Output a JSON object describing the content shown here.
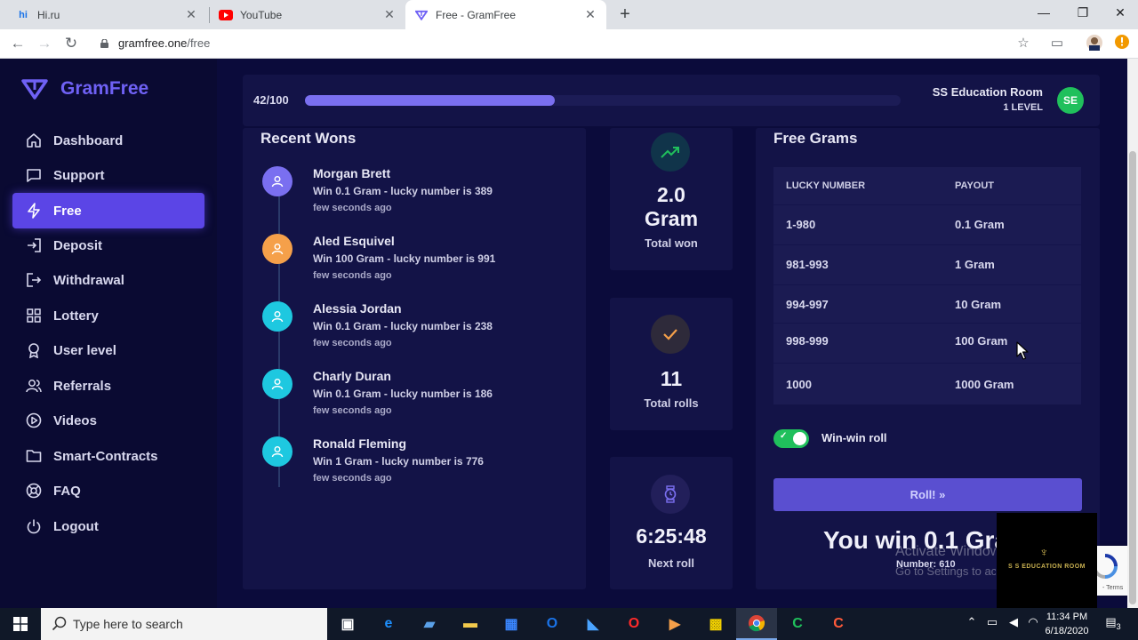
{
  "browser": {
    "tabs": [
      {
        "title": "Hi.ru",
        "icon": "hi-favicon",
        "icon_text": "hi"
      },
      {
        "title": "YouTube",
        "icon": "youtube-favicon"
      },
      {
        "title": "Free - GramFree",
        "icon": "gramfree-favicon",
        "active": true
      }
    ],
    "url_domain": "gramfree.one",
    "url_path": "/free"
  },
  "sidebar": {
    "brand": "GramFree",
    "items": [
      {
        "label": "Dashboard",
        "icon": "home-icon"
      },
      {
        "label": "Support",
        "icon": "chat-icon"
      },
      {
        "label": "Free",
        "icon": "lightning-icon",
        "active": true
      },
      {
        "label": "Deposit",
        "icon": "login-icon"
      },
      {
        "label": "Withdrawal",
        "icon": "logout-arrow-icon"
      },
      {
        "label": "Lottery",
        "icon": "grid-icon"
      },
      {
        "label": "User level",
        "icon": "award-icon"
      },
      {
        "label": "Referrals",
        "icon": "users-icon"
      },
      {
        "label": "Videos",
        "icon": "play-icon"
      },
      {
        "label": "Smart-Contracts",
        "icon": "folder-icon"
      },
      {
        "label": "FAQ",
        "icon": "lifebuoy-icon"
      },
      {
        "label": "Logout",
        "icon": "power-icon"
      }
    ]
  },
  "progress": {
    "label": "42/100",
    "value": 0.42
  },
  "user": {
    "room_name": "SS Education Room",
    "level": "1 LEVEL",
    "initials": "SE"
  },
  "recent": {
    "title": "Recent Wons",
    "items": [
      {
        "name": "Morgan Brett",
        "desc": "Win 0.1 Gram - lucky number is 389",
        "time": "few seconds ago",
        "color": "#7a6ff0"
      },
      {
        "name": "Aled Esquivel",
        "desc": "Win 100 Gram - lucky number is 991",
        "time": "few seconds ago",
        "color": "#f5a04a"
      },
      {
        "name": "Alessia Jordan",
        "desc": "Win 0.1 Gram - lucky number is 238",
        "time": "few seconds ago",
        "color": "#1ec8e0"
      },
      {
        "name": "Charly Duran",
        "desc": "Win 0.1 Gram - lucky number is 186",
        "time": "few seconds ago",
        "color": "#1ec8e0"
      },
      {
        "name": "Ronald Fleming",
        "desc": "Win 1 Gram - lucky number is 776",
        "time": "few seconds ago",
        "color": "#1ec8e0"
      }
    ]
  },
  "stats": {
    "total_won_value": "2.0",
    "total_won_unit": "Gram",
    "total_won_label": "Total won",
    "total_rolls_value": "11",
    "total_rolls_label": "Total rolls",
    "next_roll_value": "6:25:48",
    "next_roll_label": "Next roll"
  },
  "free_grams": {
    "title": "Free Grams",
    "col_lucky": "LUCKY NUMBER",
    "col_payout": "PAYOUT",
    "rows": [
      {
        "lucky": "1-980",
        "payout": "0.1 Gram"
      },
      {
        "lucky": "981-993",
        "payout": "1 Gram"
      },
      {
        "lucky": "994-997",
        "payout": "10 Gram"
      },
      {
        "lucky": "998-999",
        "payout": "100 Gram"
      },
      {
        "lucky": "1000",
        "payout": "1000 Gram"
      }
    ],
    "toggle_label": "Win-win roll",
    "roll_button": "Roll! »",
    "win_text": "You win 0.1 Gram",
    "win_number": "Number: 610"
  },
  "watermark": {
    "line1": "Activate Windows",
    "line2": "Go to Settings to activate Windows."
  },
  "overlay_logo_text": "S S EDUCATION ROOM",
  "recaptcha_terms": "- Terms",
  "taskbar": {
    "search_placeholder": "Type here to search",
    "time": "11:34 PM",
    "date": "6/18/2020",
    "notification_count": "3"
  }
}
